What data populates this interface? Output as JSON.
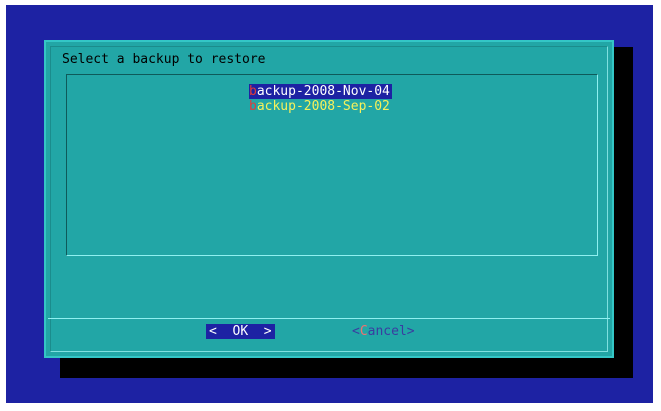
{
  "dialog": {
    "title": "Select a backup to restore"
  },
  "list": {
    "items": [
      {
        "hotkey": "b",
        "rest": "ackup-2008-Nov-04",
        "selected": true
      },
      {
        "hotkey": "b",
        "rest": "ackup-2008-Sep-02",
        "selected": false
      }
    ]
  },
  "buttons": {
    "ok": {
      "left_bracket": "<",
      "label_hot": "O",
      "label_rest": "K",
      "right_bracket": ">"
    },
    "cancel": {
      "left_bracket": "<",
      "label_hot": "C",
      "label_rest": "ancel",
      "right_bracket": ">"
    }
  },
  "colors": {
    "screen_background": "#1d22a3",
    "dialog_background": "#22a6a6",
    "selection_background": "#1d22a3",
    "hotkey": "#e23a3a",
    "unselected_text": "#f7f15a"
  }
}
